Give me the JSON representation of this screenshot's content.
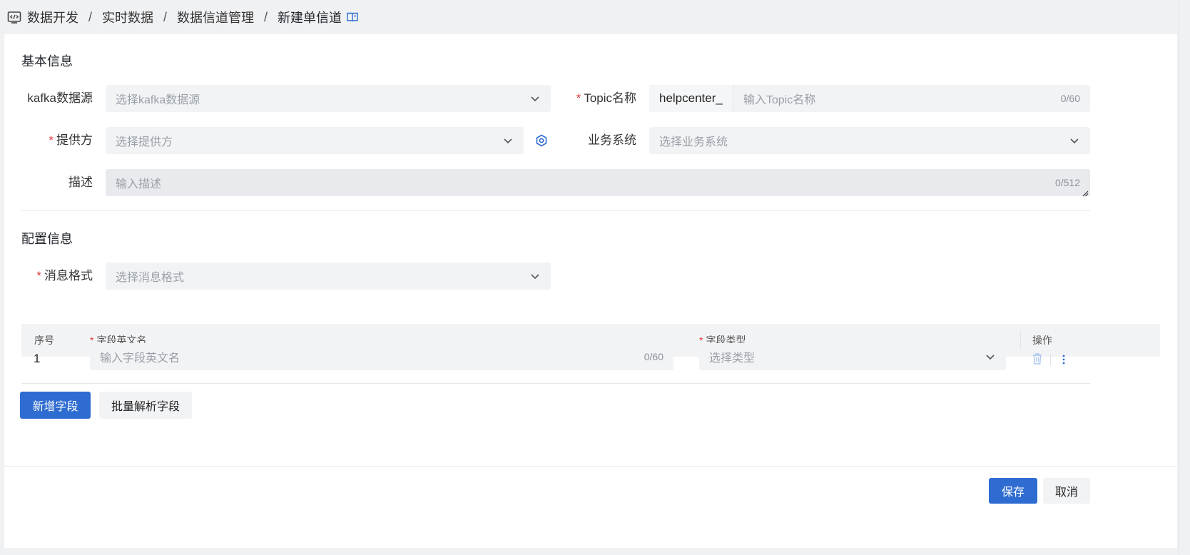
{
  "breadcrumb": {
    "items": [
      "数据开发",
      "实时数据",
      "数据信道管理"
    ],
    "current": "新建单信道",
    "separator": "/"
  },
  "basic_info": {
    "title": "基本信息",
    "kafka_label": "kafka数据源",
    "kafka_placeholder": "选择kafka数据源",
    "topic_label": "Topic名称",
    "topic_prefix": "helpcenter_",
    "topic_placeholder": "输入Topic名称",
    "topic_count": "0/60",
    "provider_label": "提供方",
    "provider_placeholder": "选择提供方",
    "business_label": "业务系统",
    "business_placeholder": "选择业务系统",
    "desc_label": "描述",
    "desc_placeholder": "输入描述",
    "desc_count": "0/512"
  },
  "config_info": {
    "title": "配置信息",
    "format_label": "消息格式",
    "format_placeholder": "选择消息格式"
  },
  "table": {
    "headers": {
      "index": "序号",
      "field_name": "字段英文名",
      "field_type": "字段类型",
      "actions": "操作"
    },
    "rows": [
      {
        "index": "1",
        "name_placeholder": "输入字段英文名",
        "name_count": "0/60",
        "type_placeholder": "选择类型"
      }
    ]
  },
  "buttons": {
    "add_field": "新增字段",
    "batch_parse": "批量解析字段",
    "save": "保存",
    "cancel": "取消"
  },
  "colors": {
    "primary": "#2e6cd1",
    "required": "#e03c3c",
    "input_bg": "#f2f3f5"
  },
  "icons": [
    "code-icon",
    "doc-link-icon",
    "chevron-down-icon",
    "settings-hex-icon",
    "trash-icon",
    "more-vertical-icon"
  ]
}
